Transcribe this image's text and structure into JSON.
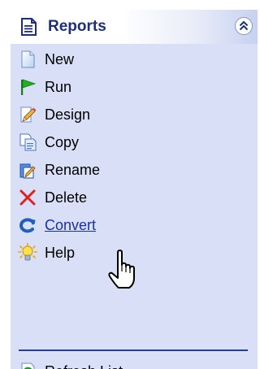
{
  "panel": {
    "title": "Reports",
    "title_icon": "report-document-icon",
    "collapse_icon": "double-chevron-up-icon",
    "colors": {
      "panel_bg": "#d8dff7",
      "title_text": "#1d2f7a",
      "link_text": "#1a2fb0",
      "divider": "#2b3f86"
    }
  },
  "tasks": [
    {
      "label": "New",
      "icon": "new-document-icon"
    },
    {
      "label": "Run",
      "icon": "green-flag-icon"
    },
    {
      "label": "Design",
      "icon": "pencil-edit-icon"
    },
    {
      "label": "Copy",
      "icon": "copy-icon"
    },
    {
      "label": "Rename",
      "icon": "rename-icon"
    },
    {
      "label": "Delete",
      "icon": "red-x-delete-icon"
    },
    {
      "label": "Convert",
      "icon": "convert-arrow-icon",
      "hovered": true
    },
    {
      "label": "Help",
      "icon": "lightbulb-help-icon"
    }
  ],
  "refresh": {
    "label": "Refresh List",
    "icon": "refresh-icon"
  },
  "cursor": {
    "icon": "hand-pointer-cursor-icon"
  }
}
